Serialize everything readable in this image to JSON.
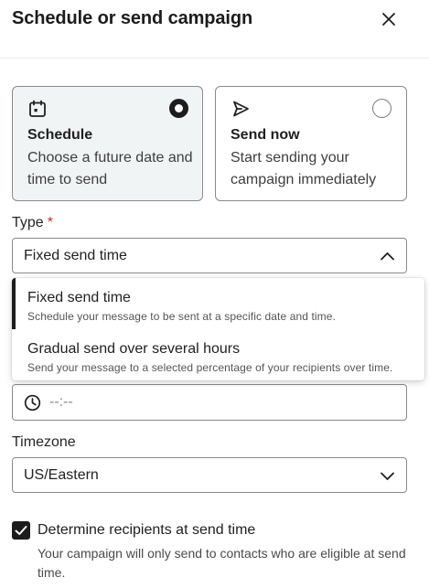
{
  "header": {
    "title": "Schedule or send campaign",
    "close_icon": "close-icon"
  },
  "delivery_options": [
    {
      "title": "Schedule",
      "description": "Choose a future date and time to send",
      "icon": "calendar-icon",
      "selected": true
    },
    {
      "title": "Send now",
      "description": "Start sending your campaign immediately",
      "icon": "send-icon",
      "selected": false
    }
  ],
  "type_field": {
    "label": "Type",
    "required_marker": "*",
    "value": "Fixed send time",
    "expanded": true,
    "options": [
      {
        "title": "Fixed send time",
        "description": "Schedule your message to be sent at a specific date and time.",
        "active": true
      },
      {
        "title": "Gradual send over several hours",
        "description": "Send your message to a selected percentage of your recipients over time.",
        "active": false
      }
    ]
  },
  "time_field": {
    "placeholder": "--:--",
    "icon": "clock-icon"
  },
  "timezone_field": {
    "label": "Timezone",
    "value": "US/Eastern"
  },
  "recipients_checkbox": {
    "checked": true,
    "label": "Determine recipients at send time",
    "help": "Your campaign will only send to contacts who are eligible at send time."
  },
  "colors": {
    "text": "#1f1f1f",
    "border": "#8a8a8a",
    "selected_card_bg": "#f1f4f5",
    "required": "#c4302b",
    "accent": "#1c1c1c"
  }
}
